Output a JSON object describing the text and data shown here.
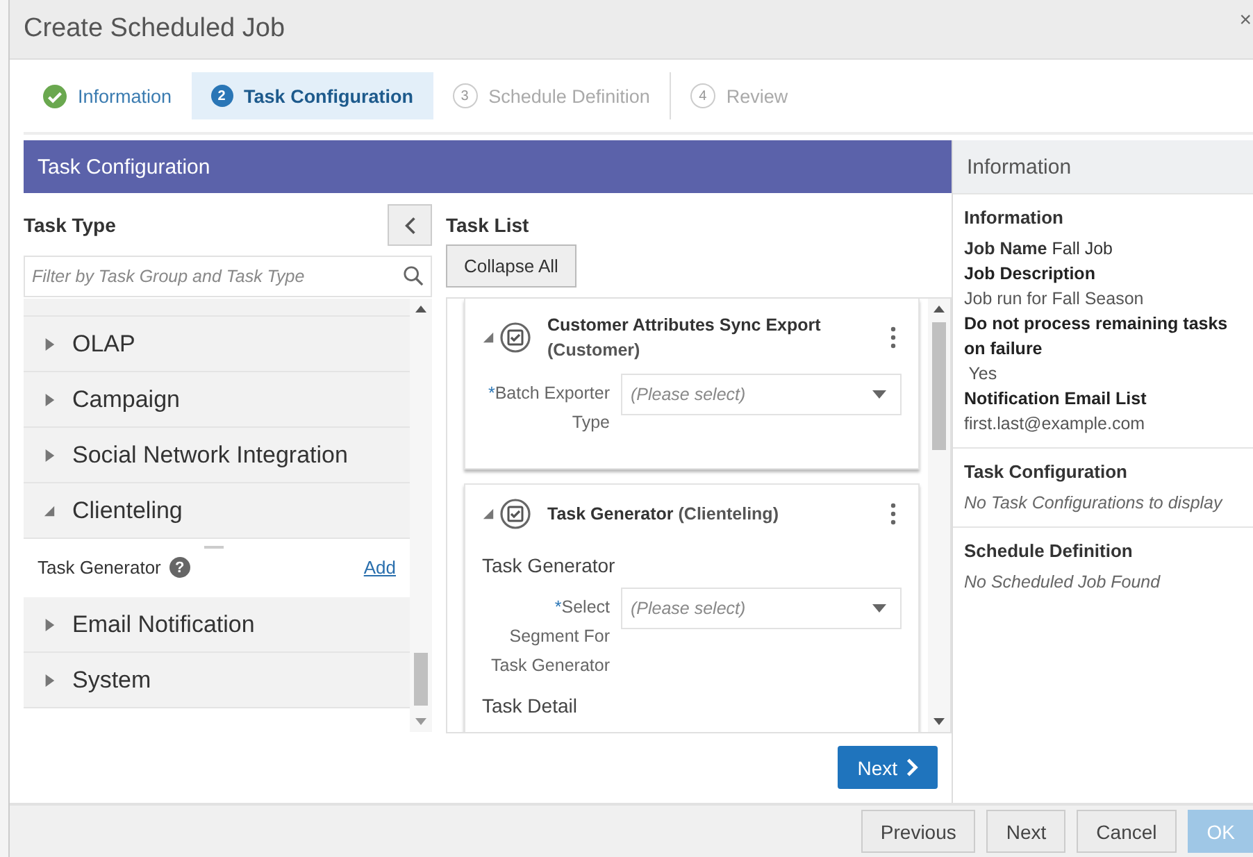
{
  "window": {
    "title": "Create Scheduled Job",
    "close": "×"
  },
  "steps": [
    {
      "label": "Information",
      "kind": "complete",
      "selected": false
    },
    {
      "label": "Task Configuration",
      "number": "2",
      "kind": "current",
      "selected": true
    },
    {
      "label": "Schedule Definition",
      "number": "3",
      "kind": "pending",
      "selected": false
    },
    {
      "label": "Review",
      "number": "4",
      "kind": "pending",
      "selected": false
    }
  ],
  "panel_header": "Task Configuration",
  "task_type": {
    "title": "Task Type",
    "filter": {
      "placeholder": "Filter by Task Group and Task Type"
    },
    "groups": [
      {
        "label": "OLAP",
        "expanded": false
      },
      {
        "label": "Campaign",
        "expanded": false
      },
      {
        "label": "Social Network Integration",
        "expanded": false
      },
      {
        "label": "Clienteling",
        "expanded": true,
        "children": [
          {
            "label": "Task Generator",
            "help": "?",
            "action": "Add"
          }
        ]
      },
      {
        "label": "Email Notification",
        "expanded": false
      },
      {
        "label": "System",
        "expanded": false
      }
    ]
  },
  "task_list": {
    "title": "Task List",
    "collapse_button": "Collapse All",
    "cards": [
      {
        "title": "Customer Attributes Sync Export",
        "group": "(Customer)",
        "expanded": true,
        "items": [
          {
            "kind": "select",
            "label": "Batch Exporter Type",
            "required_mark": "*",
            "placeholder": "(Please select)"
          }
        ]
      },
      {
        "title": "Task Generator",
        "group": "(Clienteling)",
        "expanded": true,
        "items": [
          {
            "kind": "heading",
            "label": "Task Generator"
          },
          {
            "kind": "select",
            "label": "Select Segment For Task Generator",
            "required_mark": "*",
            "placeholder": "(Please select)"
          },
          {
            "kind": "heading",
            "label": "Task Detail"
          }
        ]
      }
    ],
    "next_button": "Next"
  },
  "info_panel": {
    "title": "Information",
    "sections": [
      {
        "title": "Information",
        "rows": [
          {
            "kind": "inline",
            "label": "Job Name",
            "value": "Fall Job"
          },
          {
            "kind": "label",
            "text": "Job Description"
          },
          {
            "kind": "value",
            "text": "Job run for Fall Season"
          },
          {
            "kind": "label",
            "text": "Do not process remaining tasks on failure"
          },
          {
            "kind": "value",
            "text": " Yes"
          },
          {
            "kind": "label",
            "text": "Notification Email List"
          },
          {
            "kind": "value",
            "text": "first.last@example.com"
          }
        ]
      },
      {
        "title": "Task Configuration",
        "rows": [
          {
            "kind": "empty",
            "text": "No Task Configurations to display"
          }
        ]
      },
      {
        "title": "Schedule Definition",
        "rows": [
          {
            "kind": "empty",
            "text": "No Scheduled Job Found"
          }
        ]
      }
    ]
  },
  "footer_buttons": [
    {
      "label": "Previous",
      "kind": "secondary",
      "disabled": false
    },
    {
      "label": "Next",
      "kind": "secondary",
      "disabled": false
    },
    {
      "label": "Cancel",
      "kind": "secondary",
      "disabled": false
    },
    {
      "label": "OK",
      "kind": "primary",
      "disabled": true
    }
  ]
}
